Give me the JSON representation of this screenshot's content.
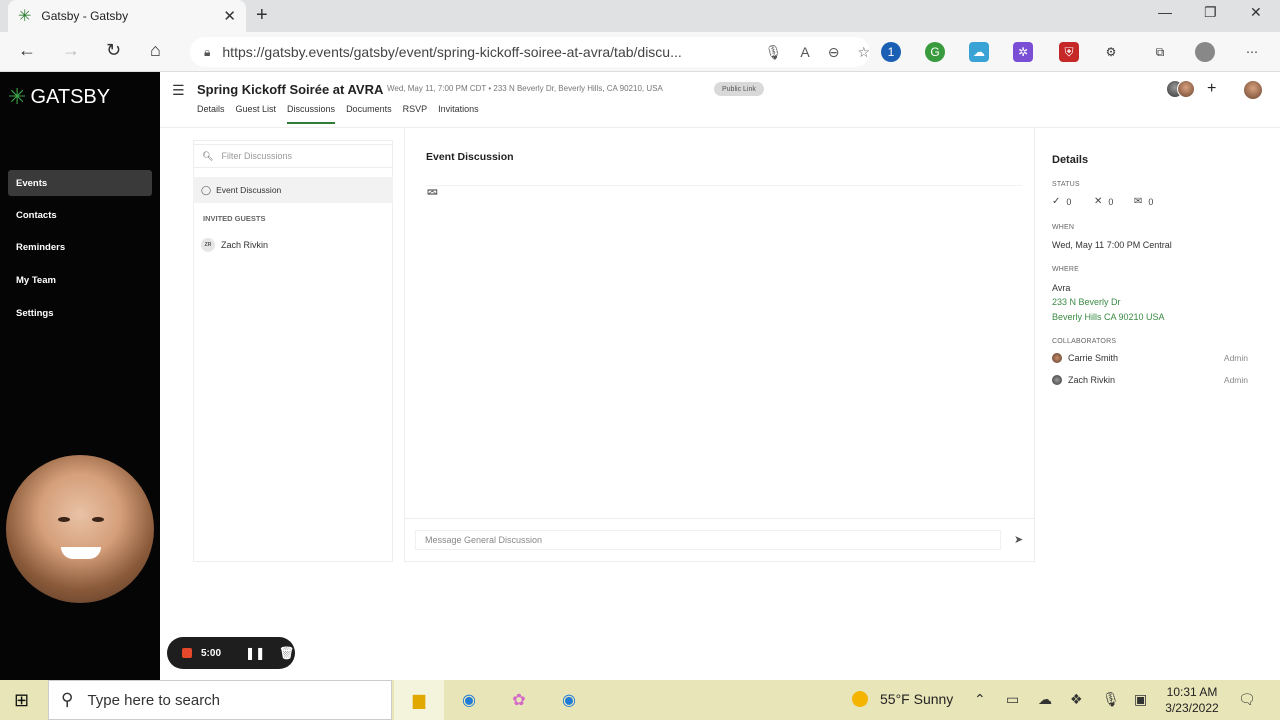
{
  "browser": {
    "tab_title": "Gatsby - Gatsby",
    "url": "https://gatsby.events/gatsby/event/spring-kickoff-soiree-at-avra/tab/discu..."
  },
  "app": {
    "logo": "GATSBY",
    "nav": [
      "Events",
      "Contacts",
      "Reminders",
      "My Team",
      "Settings"
    ],
    "recording_time": "5:00"
  },
  "event": {
    "title": "Spring Kickoff Soirée at AVRA",
    "meta": "Wed, May 11, 7:00 PM CDT • 233 N Beverly Dr, Beverly Hills, CA 90210, USA",
    "public_link": "Public Link",
    "tabs": [
      "Details",
      "Guest List",
      "Discussions",
      "Documents",
      "RSVP",
      "Invitations"
    ]
  },
  "discussions": {
    "filter_placeholder": "Filter Discussions",
    "items": [
      "Event Discussion"
    ],
    "invited_label": "INVITED GUESTS",
    "guests": [
      {
        "initials": "ZR",
        "name": "Zach Rivkin"
      }
    ]
  },
  "center": {
    "title": "Event Discussion",
    "message_placeholder": "Message General Discussion"
  },
  "details": {
    "title": "Details",
    "status_label": "STATUS",
    "status": {
      "accepted": "0",
      "declined": "0",
      "pending": "0"
    },
    "when_label": "WHEN",
    "when": "Wed, May 11 7:00 PM Central",
    "where_label": "WHERE",
    "venue": "Avra",
    "address1": "233 N Beverly Dr",
    "address2": "Beverly Hills CA 90210 USA",
    "collab_label": "COLLABORATORS",
    "collaborators": [
      {
        "name": "Carrie Smith",
        "role": "Admin"
      },
      {
        "name": "Zach Rivkin",
        "role": "Admin"
      }
    ]
  },
  "taskbar": {
    "search_placeholder": "Type here to search",
    "weather": "55°F  Sunny",
    "time": "10:31 AM",
    "date": "3/23/2022"
  }
}
